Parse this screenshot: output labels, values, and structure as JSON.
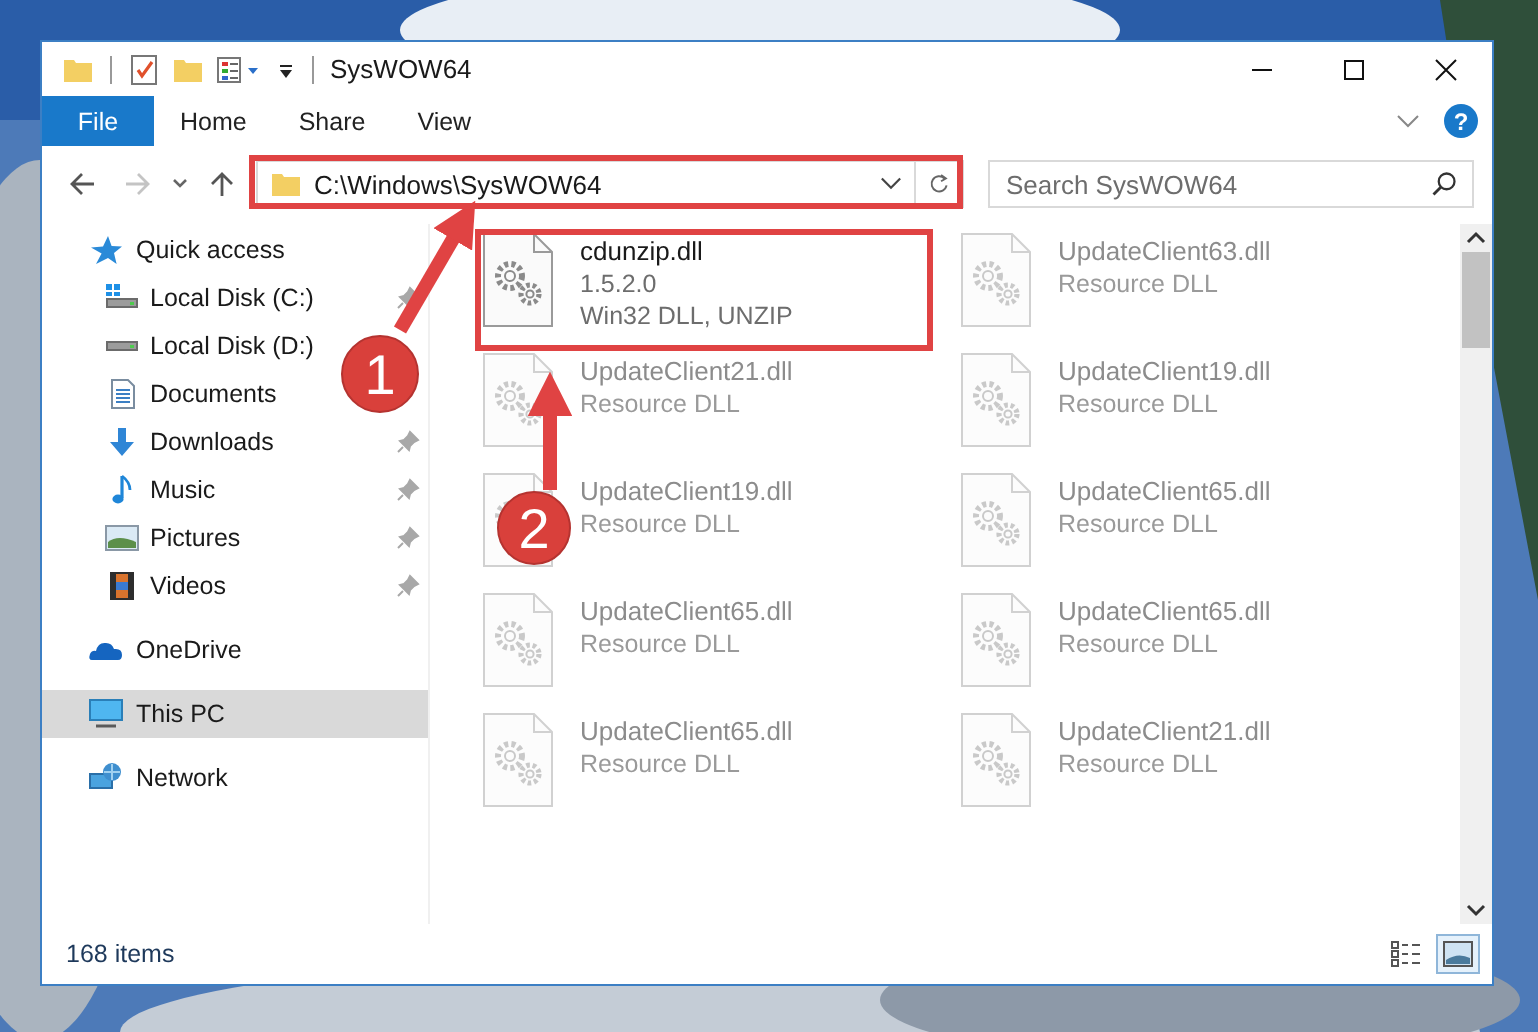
{
  "window": {
    "title": "SysWOW64"
  },
  "ribbon": {
    "tabs": [
      {
        "label": "File",
        "kind": "menu",
        "selected": false
      },
      {
        "label": "Home",
        "kind": "tab",
        "selected": false
      },
      {
        "label": "Share",
        "kind": "tab",
        "selected": false
      },
      {
        "label": "View",
        "kind": "tab",
        "selected": false
      }
    ],
    "help": "?"
  },
  "nav": {
    "back_disabled": false,
    "forward_disabled": true
  },
  "address": {
    "path": "C:\\Windows\\SysWOW64"
  },
  "search": {
    "placeholder": "Search SysWOW64"
  },
  "sidebar": {
    "items": [
      {
        "label": "Quick access",
        "selected": false,
        "children": [
          {
            "label": "Local Disk (C:)",
            "pinned": true
          },
          {
            "label": "Local Disk (D:)",
            "pinned": false
          },
          {
            "label": "Documents",
            "pinned": false
          },
          {
            "label": "Downloads",
            "pinned": true
          },
          {
            "label": "Music",
            "pinned": true
          },
          {
            "label": "Pictures",
            "pinned": true
          },
          {
            "label": "Videos",
            "pinned": true
          }
        ]
      },
      {
        "label": "OneDrive",
        "selected": false
      },
      {
        "label": "This PC",
        "selected": true
      },
      {
        "label": "Network",
        "selected": false
      }
    ]
  },
  "files": [
    {
      "name": "cdunzip.dll",
      "version": "1.5.2.0",
      "description": "Win32 DLL, UNZIP",
      "dimmed": false
    },
    {
      "name": "UpdateClient63.dll",
      "description": "Resource DLL",
      "dimmed": true
    },
    {
      "name": "UpdateClient21.dll",
      "description": "Resource DLL",
      "dimmed": true
    },
    {
      "name": "UpdateClient19.dll",
      "description": "Resource DLL",
      "dimmed": true
    },
    {
      "name": "UpdateClient19.dll",
      "description": "Resource DLL",
      "dimmed": true
    },
    {
      "name": "UpdateClient65.dll",
      "description": "Resource DLL",
      "dimmed": true
    },
    {
      "name": "UpdateClient65.dll",
      "description": "Resource DLL",
      "dimmed": true
    },
    {
      "name": "UpdateClient65.dll",
      "description": "Resource DLL",
      "dimmed": true
    },
    {
      "name": "UpdateClient65.dll",
      "description": "Resource DLL",
      "dimmed": true
    },
    {
      "name": "UpdateClient21.dll",
      "description": "Resource DLL",
      "dimmed": true
    }
  ],
  "annotations": {
    "markers": [
      {
        "label": "1"
      },
      {
        "label": "2"
      }
    ]
  },
  "status_bar": {
    "count": "168 items",
    "views": [
      {
        "selected": false
      },
      {
        "selected": true
      }
    ]
  }
}
